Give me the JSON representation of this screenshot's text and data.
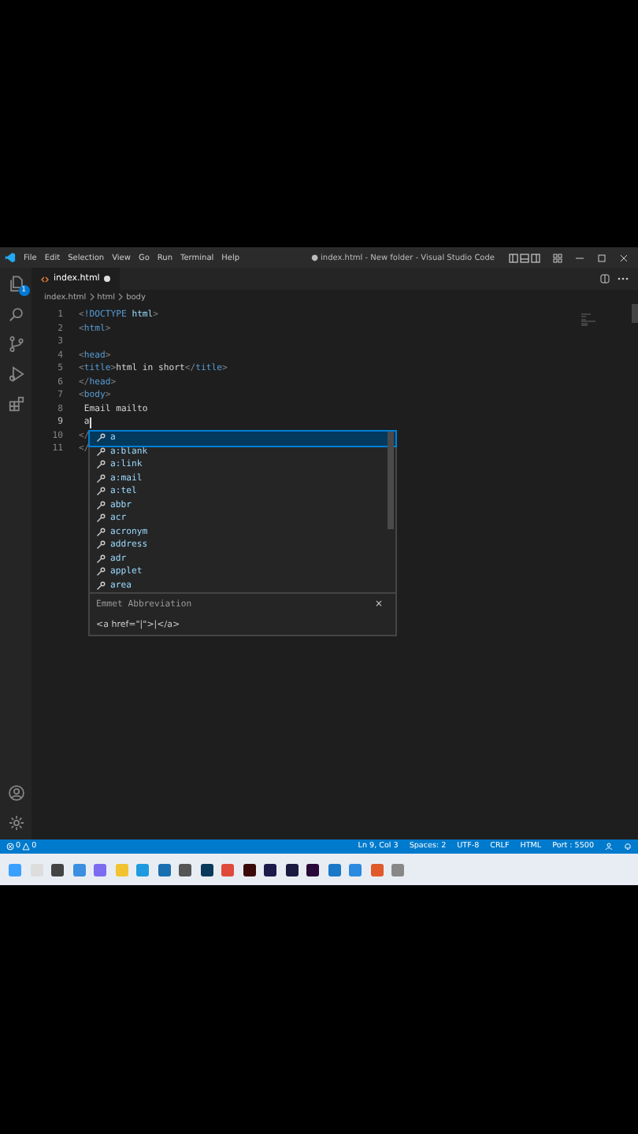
{
  "window": {
    "title": "● index.html - New folder - Visual Studio Code"
  },
  "menu": [
    "File",
    "Edit",
    "Selection",
    "View",
    "Go",
    "Run",
    "Terminal",
    "Help"
  ],
  "activity_bar": {
    "explorer_badge": "1"
  },
  "tabs": [
    {
      "label": "index.html",
      "selected": true,
      "modified": true
    }
  ],
  "breadcrumbs": [
    "index.html",
    "html",
    "body"
  ],
  "code": [
    {
      "number": "1",
      "tokens": [
        {
          "kind": "bracket",
          "text": "<"
        },
        {
          "kind": "tag",
          "text": "!DOCTYPE"
        },
        {
          "kind": "attr",
          "text": " html"
        },
        {
          "kind": "bracket",
          "text": ">"
        }
      ]
    },
    {
      "number": "2",
      "tokens": [
        {
          "kind": "bracket",
          "text": "<"
        },
        {
          "kind": "tag",
          "text": "html"
        },
        {
          "kind": "bracket",
          "text": ">"
        }
      ]
    },
    {
      "number": "3"
    },
    {
      "number": "4",
      "tokens": [
        {
          "kind": "bracket",
          "text": "<"
        },
        {
          "kind": "tag",
          "text": "head"
        },
        {
          "kind": "bracket",
          "text": ">"
        }
      ]
    },
    {
      "number": "5",
      "tokens": [
        {
          "kind": "bracket",
          "text": "<"
        },
        {
          "kind": "tag",
          "text": "title"
        },
        {
          "kind": "bracket",
          "text": ">"
        },
        {
          "kind": "text",
          "text": "html in short"
        },
        {
          "kind": "bracket",
          "text": "</"
        },
        {
          "kind": "tag",
          "text": "title"
        },
        {
          "kind": "bracket",
          "text": ">"
        }
      ]
    },
    {
      "number": "6",
      "tokens": [
        {
          "kind": "bracket",
          "text": "</"
        },
        {
          "kind": "tag",
          "text": "head"
        },
        {
          "kind": "bracket",
          "text": ">"
        }
      ]
    },
    {
      "number": "7",
      "tokens": [
        {
          "kind": "bracket",
          "text": "<"
        },
        {
          "kind": "tag",
          "text": "body"
        },
        {
          "kind": "bracket",
          "text": ">"
        }
      ]
    },
    {
      "number": "8",
      "tokens": [
        {
          "kind": "text",
          "text": " Email mailto"
        }
      ]
    },
    {
      "number": "9",
      "tokens": [
        {
          "kind": "text",
          "text": " a"
        }
      ],
      "cursor": true
    },
    {
      "number": "10",
      "tokens": [
        {
          "kind": "bracket",
          "text": "</"
        }
      ]
    },
    {
      "number": "11",
      "tokens": [
        {
          "kind": "bracket",
          "text": "</"
        }
      ]
    }
  ],
  "suggestions": {
    "items": [
      {
        "label": "a",
        "selected": true
      },
      {
        "label": "a:blank",
        "selected": false
      },
      {
        "label": "a:link",
        "selected": false
      },
      {
        "label": "a:mail",
        "selected": false
      },
      {
        "label": "a:tel",
        "selected": false
      },
      {
        "label": "abbr",
        "selected": false
      },
      {
        "label": "acr",
        "selected": false
      },
      {
        "label": "acronym",
        "selected": false
      },
      {
        "label": "address",
        "selected": false
      },
      {
        "label": "adr",
        "selected": false
      },
      {
        "label": "applet",
        "selected": false
      },
      {
        "label": "area",
        "selected": false
      }
    ],
    "detail_title": "Emmet Abbreviation",
    "detail_close": "×",
    "detail_preview": "<a href=\"|\">|</a>"
  },
  "status_bar": {
    "errors": "0",
    "warnings": "0",
    "items": [
      "Ln 9, Col 3",
      "Spaces: 2",
      "UTF-8",
      "CRLF",
      "HTML",
      "Port : 5500"
    ]
  }
}
